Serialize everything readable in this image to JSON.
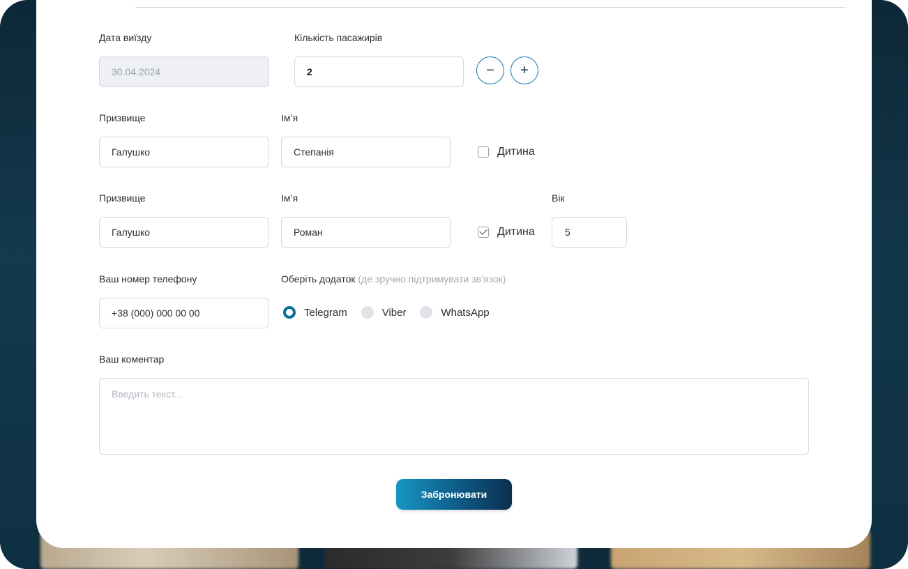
{
  "trip": {
    "date_label": "Дата виїзду",
    "date_value": "30.04.2024",
    "passengers_label": "Кількість пасажирів",
    "passengers_value": "2",
    "decrement_symbol": "−",
    "increment_symbol": "+"
  },
  "passengers": [
    {
      "surname_label": "Призвище",
      "surname_value": "Галушко",
      "name_label": "Ім’я",
      "name_value": "Степанія",
      "child_label": "Дитина",
      "child_checked": false
    },
    {
      "surname_label": "Призвище",
      "surname_value": "Галушко",
      "name_label": "Ім’я",
      "name_value": "Роман",
      "child_label": "Дитина",
      "child_checked": true,
      "age_label": "Вік",
      "age_value": "5"
    }
  ],
  "contact": {
    "phone_label": "Ваш номер телефону",
    "phone_value": "+38 (000) 000 00 00",
    "app_label": "Оберіть додаток",
    "app_hint": "(де зручно підтримувати зв’язок)",
    "apps": [
      "Telegram",
      "Viber",
      "WhatsApp"
    ],
    "selected_app": "Telegram"
  },
  "comment": {
    "label": "Ваш коментар",
    "placeholder": "Введить текст..."
  },
  "submit_label": "Забронювати",
  "colors": {
    "accent": "#0c6f98",
    "button_gradient_start": "#1795c4",
    "button_gradient_end": "#0a2f4d",
    "frame": "#0f2b3b"
  }
}
